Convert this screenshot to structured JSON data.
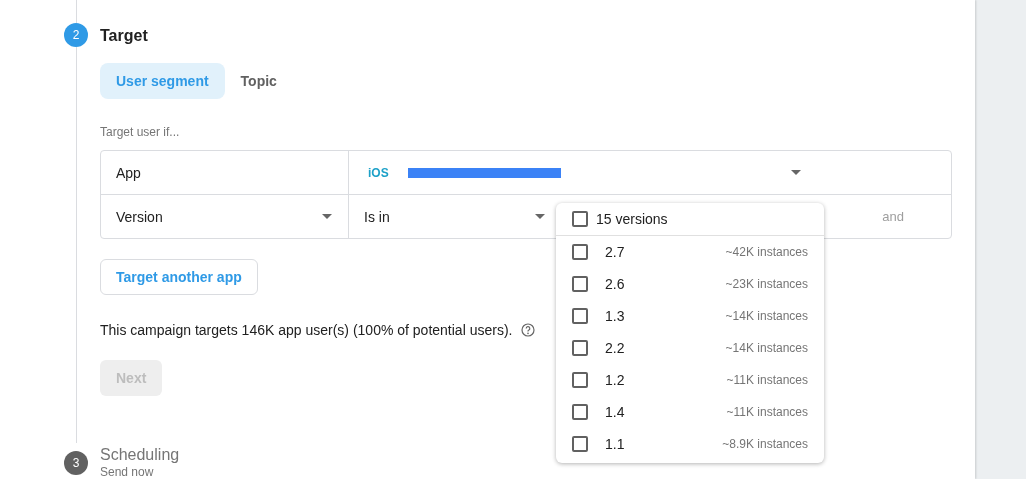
{
  "step": {
    "number": "2",
    "title": "Target"
  },
  "tabs": [
    {
      "label": "User segment",
      "selected": true
    },
    {
      "label": "Topic",
      "selected": false
    }
  ],
  "condition_label": "Target user if...",
  "conditions": [
    {
      "kind": "app",
      "field": "App",
      "platform": "iOS",
      "redacted": true
    },
    {
      "kind": "version",
      "field": "Version",
      "operator": "Is in",
      "joiner": "and"
    }
  ],
  "version_menu": {
    "header": {
      "label": "15 versions",
      "checked": false
    },
    "options": [
      {
        "label": "2.7",
        "count": "~42K instances",
        "checked": false
      },
      {
        "label": "2.6",
        "count": "~23K instances",
        "checked": false
      },
      {
        "label": "1.3",
        "count": "~14K instances",
        "checked": false
      },
      {
        "label": "2.2",
        "count": "~14K instances",
        "checked": false
      },
      {
        "label": "1.2",
        "count": "~11K instances",
        "checked": false
      },
      {
        "label": "1.4",
        "count": "~11K instances",
        "checked": false
      },
      {
        "label": "1.1",
        "count": "~8.9K instances",
        "checked": false
      }
    ]
  },
  "add_app_button": "Target another app",
  "summary": "This campaign targets 146K app user(s) (100% of potential users).",
  "next_button": {
    "label": "Next",
    "disabled": true
  },
  "next_step": {
    "number": "3",
    "title": "Scheduling",
    "subtitle": "Send now"
  }
}
